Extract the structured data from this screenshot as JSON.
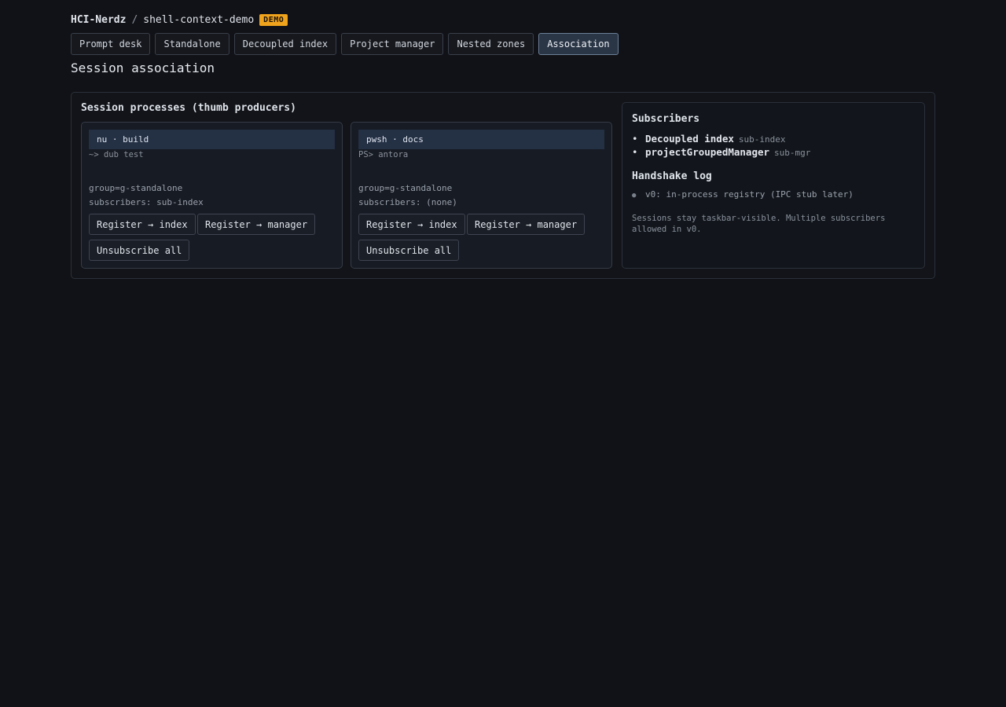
{
  "breadcrumb": {
    "org": "HCI-Nerdz",
    "separator": "/",
    "repo": "shell-context-demo",
    "badge": "DEMO"
  },
  "tabs": [
    {
      "label": "Prompt desk",
      "active": false
    },
    {
      "label": "Standalone",
      "active": false
    },
    {
      "label": "Decoupled index",
      "active": false
    },
    {
      "label": "Project manager",
      "active": false
    },
    {
      "label": "Nested zones",
      "active": false
    },
    {
      "label": "Association",
      "active": true
    }
  ],
  "page_title": "Session association",
  "processes_panel": {
    "title": "Session processes (thumb producers)",
    "processes": [
      {
        "header": "nu · build",
        "command": "~> dub test",
        "group": "group=g-standalone",
        "subscribers": "subscribers: sub-index",
        "register_index_label": "Register → index",
        "register_manager_label": "Register → manager",
        "unsubscribe_label": "Unsubscribe all"
      },
      {
        "header": "pwsh · docs",
        "command": "PS> antora",
        "group": "group=g-standalone",
        "subscribers": "subscribers: (none)",
        "register_index_label": "Register → index",
        "register_manager_label": "Register → manager",
        "unsubscribe_label": "Unsubscribe all"
      }
    ]
  },
  "subscribers_panel": {
    "title": "Subscribers",
    "items": [
      {
        "name": "Decoupled index",
        "id": "sub-index"
      },
      {
        "name": "projectGroupedManager",
        "id": "sub-mgr"
      }
    ],
    "log_title": "Handshake log",
    "log_items": [
      "v0: in-process registry (IPC stub later)"
    ],
    "note": "Sessions stay taskbar-visible. Multiple subscribers allowed in v0."
  },
  "colors": {
    "background": "#111217",
    "badge": "#f0a31c",
    "active_tab": "#2a3545",
    "process_header": "#243044"
  }
}
